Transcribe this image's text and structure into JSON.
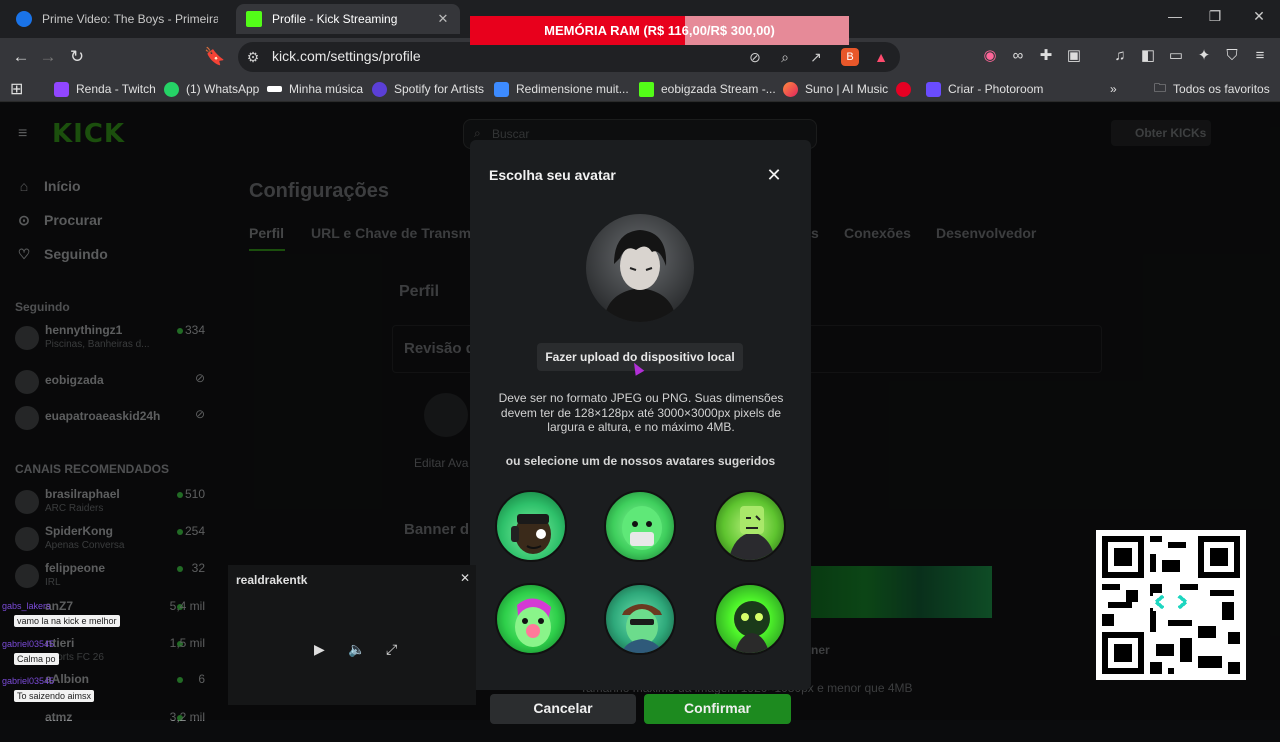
{
  "browser": {
    "tabs": [
      {
        "title": "Prime Video: The Boys - Primeira Tem",
        "favicon_color": "#1a73e8"
      },
      {
        "title": "Profile - Kick Streaming",
        "favicon_color": "#53fc18"
      }
    ],
    "url": "kick.com/settings/profile",
    "ram_banner": "MEMÓRIA RAM (R$ 116,00/R$ 300,00)",
    "bookmarks": [
      "Renda - Twitch",
      "(1) WhatsApp",
      "Minha música",
      "Spotify for Artists",
      "Redimensione muit...",
      "eobigzada Stream -...",
      "Suno | AI Music",
      "Criar - Photoroom"
    ],
    "all_bookmarks_label": "Todos os favoritos"
  },
  "kick": {
    "search_placeholder": "Buscar",
    "get_kicks_label": "Obter KICKs",
    "nav": [
      "Início",
      "Procurar",
      "Seguindo"
    ],
    "following_header": "Seguindo",
    "following": [
      {
        "name": "hennythingz1",
        "sub": "Piscinas, Banheiras d...",
        "count": "334"
      },
      {
        "name": "eobigzada",
        "sub": "",
        "count": ""
      },
      {
        "name": "euapatroaeaskid24h",
        "sub": "",
        "count": ""
      }
    ],
    "recommended_header": "CANAIS RECOMENDADOS",
    "recommended": [
      {
        "name": "brasilraphael",
        "sub": "ARC Raiders",
        "count": "510"
      },
      {
        "name": "SpiderKong",
        "sub": "Apenas Conversa",
        "count": "254"
      },
      {
        "name": "felippeone",
        "sub": "IRL",
        "count": "32"
      },
      {
        "name": "anZ7",
        "sub": "",
        "count": "5,4 mil"
      },
      {
        "name": "ntieri",
        "sub": "Sports FC 26",
        "count": "1,5 mil"
      },
      {
        "name": "aAlbion",
        "sub": "",
        "count": "6"
      },
      {
        "name": "atmz",
        "sub": "",
        "count": "3,2 mil"
      }
    ],
    "settings_title": "Configurações",
    "settings_tabs": [
      "Perfil",
      "URL e Chave de Transmi",
      "s",
      "Conexões",
      "Desenvolvedor"
    ],
    "profile_section": "Perfil",
    "review_label": "Revisão d",
    "edit_avatar_label": "Editar Ava",
    "banner_label": "Banner d",
    "banner_hint": "Tamanho máximo da imagem 1920×1080px e menor que 4MB",
    "banner_btn": "ner"
  },
  "modal": {
    "title": "Escolha seu avatar",
    "upload_button": "Fazer upload do dispositivo local",
    "upload_description": "Deve ser no formato JPEG ou PNG. Suas dimensões devem ter de 128×128px até 3000×3000px pixels de largura e altura, e no máximo 4MB.",
    "suggested_label": "ou selecione um de nossos avatares sugeridos",
    "cancel": "Cancelar",
    "confirm": "Confirmar",
    "suggested_avatars": [
      "avatar-headphones",
      "avatar-mask",
      "avatar-hoodie",
      "avatar-pink-nose",
      "avatar-cap",
      "avatar-glow"
    ]
  },
  "overlay": {
    "mini_player_channel": "realdrakentk",
    "chat": [
      {
        "user": "gabs_lakers",
        "text": "vamo la na kick e melhor"
      },
      {
        "user": "gabriel03545",
        "text": "Calma po"
      },
      {
        "user": "gabriel03545",
        "text": "To saizendo aimsx"
      }
    ]
  },
  "colors": {
    "kick_green": "#53fc18",
    "confirm_green": "#1d8a1f",
    "modal_bg": "#1b1d1f"
  }
}
